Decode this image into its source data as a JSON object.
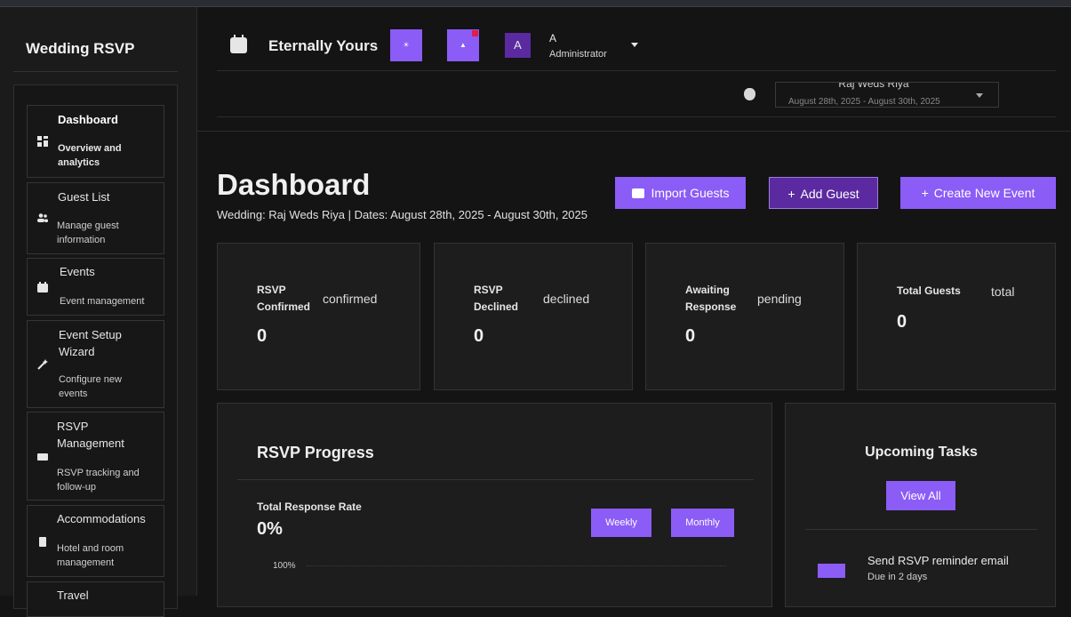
{
  "sidebar": {
    "brand": "Wedding RSVP",
    "items": [
      {
        "label": "Dashboard",
        "sub": "Overview and analytics",
        "icon": "dashboard-grid-icon"
      },
      {
        "label": "Guest List",
        "sub": "Manage guest information",
        "icon": "users-icon"
      },
      {
        "label": "Events",
        "sub": "Event management",
        "icon": "calendar-icon"
      },
      {
        "label": "Event Setup Wizard",
        "sub": "Configure new events",
        "icon": "magic-wand-icon"
      },
      {
        "label": "RSVP Management",
        "sub": "RSVP tracking and follow-up",
        "icon": "mail-icon"
      },
      {
        "label": "Accommodations",
        "sub": "Hotel and room management",
        "icon": "hotel-icon"
      },
      {
        "label": "Travel",
        "sub": "",
        "icon": "plane-icon"
      }
    ]
  },
  "header": {
    "event_name": "Eternally Yours",
    "avatar_initial": "A",
    "user_name": "A",
    "user_role": "Administrator"
  },
  "wedding_selector": {
    "value": "Raj Weds Riya",
    "subtext": "August 28th, 2025 - August 30th, 2025"
  },
  "page": {
    "title": "Dashboard",
    "subtitle": "Wedding: Raj Weds Riya | Dates: August 28th, 2025 - August 30th, 2025"
  },
  "actions": {
    "import": "Import Guests",
    "add": "Add Guest",
    "create": "Create New Event"
  },
  "stats": [
    {
      "label_1": "RSVP",
      "label_2": "Confirmed",
      "tag": "confirmed",
      "value": "0"
    },
    {
      "label_1": "RSVP",
      "label_2": "Declined",
      "tag": "declined",
      "value": "0"
    },
    {
      "label_1": "Awaiting",
      "label_2": "Response",
      "tag": "pending",
      "value": "0"
    },
    {
      "label_1": "Total Guests",
      "label_2": "",
      "tag": "total",
      "value": "0"
    }
  ],
  "progress": {
    "title": "RSVP Progress",
    "rate_label": "Total Response Rate",
    "rate_value": "0%",
    "rate_fraction": 0,
    "weekly": "Weekly",
    "monthly": "Monthly",
    "axis_top": "100%"
  },
  "tasks": {
    "title": "Upcoming Tasks",
    "view_all": "View All",
    "items": [
      {
        "title": "Send RSVP reminder email",
        "due": "Due in 2 days"
      }
    ]
  },
  "colors": {
    "accent": "#8b5cf6",
    "accent_dark": "#5b2aa0",
    "notification": "#e11d48",
    "background": "#141414"
  }
}
